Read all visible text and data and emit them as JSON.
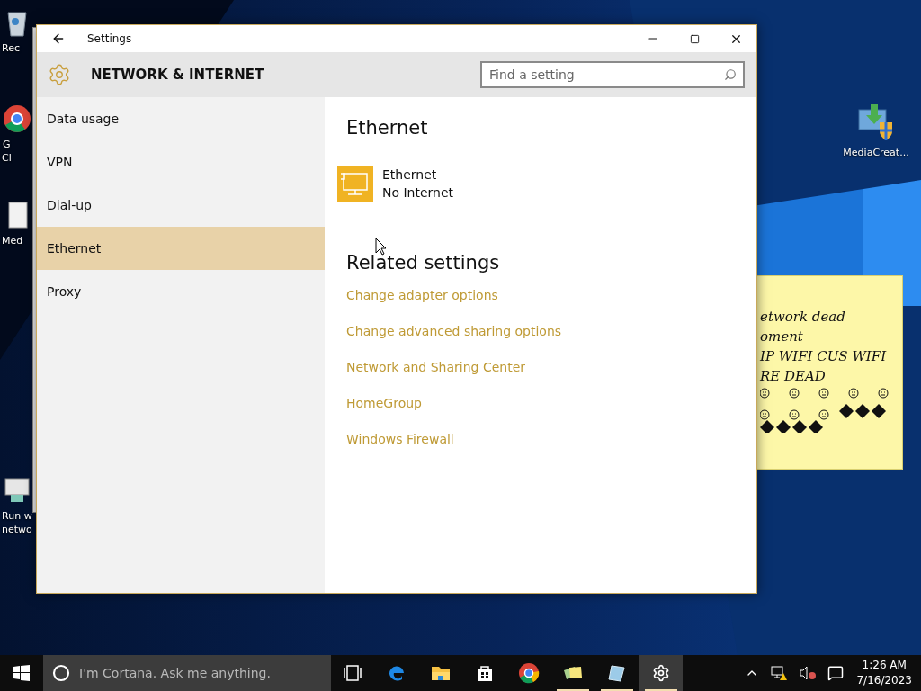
{
  "desktop_icons_left": [
    {
      "kind": "bin",
      "label_lines": [
        "Rec"
      ]
    },
    {
      "kind": "chrome",
      "label_lines": [
        "G",
        "Cl"
      ]
    },
    {
      "kind": "doc",
      "label_lines": [
        "Med"
      ]
    },
    {
      "kind": "run",
      "label_lines": [
        "Run w",
        "netwo"
      ]
    }
  ],
  "desktop_icons_right": [
    {
      "kind": "media",
      "label_lines": [
        "MediaCreat..."
      ]
    }
  ],
  "back_window": {
    "kind": "window"
  },
  "sticky_note": {
    "lines": [
      "etwork dead",
      "oment",
      "IP WIFI CUS WIFI",
      "RE DEAD"
    ]
  },
  "settings": {
    "title": "Settings",
    "section": "NETWORK & INTERNET",
    "search": {
      "placeholder": "Find a setting"
    },
    "nav": [
      {
        "label": "Data usage",
        "selected": false
      },
      {
        "label": "VPN",
        "selected": false
      },
      {
        "label": "Dial-up",
        "selected": false
      },
      {
        "label": "Ethernet",
        "selected": true
      },
      {
        "label": "Proxy",
        "selected": false
      }
    ],
    "content": {
      "heading": "Ethernet",
      "connection": {
        "name": "Ethernet",
        "status": "No Internet"
      },
      "related_heading": "Related settings",
      "links": [
        "Change adapter options",
        "Change advanced sharing options",
        "Network and Sharing Center",
        "HomeGroup",
        "Windows Firewall"
      ]
    }
  },
  "taskbar": {
    "search": {
      "placeholder": "I'm Cortana. Ask me anything."
    },
    "apps": [
      {
        "kind": "taskview",
        "running": false,
        "active": false
      },
      {
        "kind": "edge",
        "running": false,
        "active": false
      },
      {
        "kind": "explorer",
        "running": false,
        "active": false
      },
      {
        "kind": "store",
        "running": false,
        "active": false
      },
      {
        "kind": "chrome",
        "running": false,
        "active": false
      },
      {
        "kind": "sticky",
        "running": true,
        "active": false
      },
      {
        "kind": "notepad",
        "running": true,
        "active": false
      },
      {
        "kind": "settings",
        "running": true,
        "active": true
      }
    ],
    "clock": {
      "time": "1:26 AM",
      "date": "7/16/2023"
    }
  }
}
